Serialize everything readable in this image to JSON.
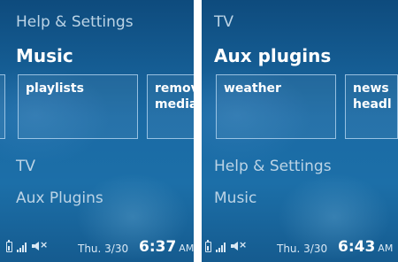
{
  "left": {
    "menu_above": "Help & Settings",
    "selected_title": "Music",
    "tiles": [
      "",
      "playlists",
      "remove\nmedia"
    ],
    "menu_below": [
      "TV",
      "Aux Plugins"
    ],
    "status": {
      "date": "Thu. 3/30",
      "time": "6:37",
      "ampm": "AM"
    }
  },
  "right": {
    "menu_above": "TV",
    "selected_title": "Aux plugins",
    "tiles": [
      "weather",
      "news\nheadl"
    ],
    "menu_below": [
      "Help & Settings",
      "Music"
    ],
    "status": {
      "date": "Thu. 3/30",
      "time": "6:43",
      "ampm": "AM"
    }
  },
  "icons": [
    "battery-icon",
    "signal-icon",
    "mute-icon"
  ],
  "colors": {
    "background": "#1a6aa4",
    "text": "#ffffff",
    "dim_text": "#bcd4e6"
  }
}
